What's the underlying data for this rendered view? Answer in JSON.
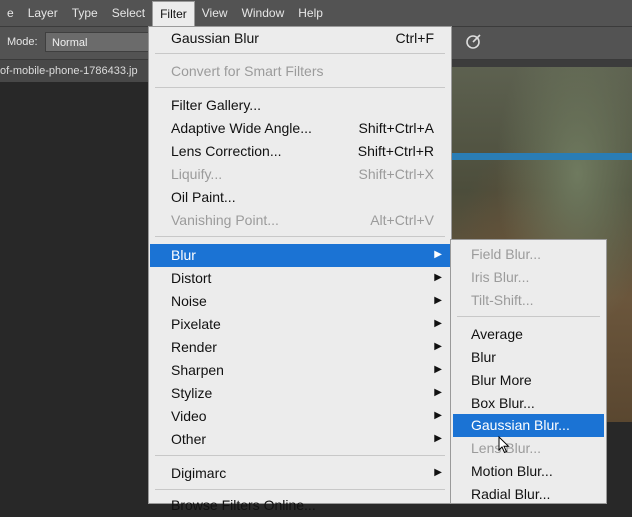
{
  "menubar": {
    "items": [
      "e",
      "Layer",
      "Type",
      "Select",
      "Filter",
      "View",
      "Window",
      "Help"
    ],
    "active": "Filter"
  },
  "options": {
    "mode_label": "Mode:",
    "mode_value": "Normal"
  },
  "document_tab": {
    "title": "of-mobile-phone-1786433.jp"
  },
  "filter_menu": {
    "last_filter": {
      "label": "Gaussian Blur",
      "shortcut": "Ctrl+F"
    },
    "convert_smart": {
      "label": "Convert for Smart Filters"
    },
    "filter_gallery": {
      "label": "Filter Gallery..."
    },
    "adaptive_wide_angle": {
      "label": "Adaptive Wide Angle...",
      "shortcut": "Shift+Ctrl+A"
    },
    "lens_correction": {
      "label": "Lens Correction...",
      "shortcut": "Shift+Ctrl+R"
    },
    "liquify": {
      "label": "Liquify...",
      "shortcut": "Shift+Ctrl+X"
    },
    "oil_paint": {
      "label": "Oil Paint..."
    },
    "vanishing_point": {
      "label": "Vanishing Point...",
      "shortcut": "Alt+Ctrl+V"
    },
    "blur": {
      "label": "Blur"
    },
    "distort": {
      "label": "Distort"
    },
    "noise": {
      "label": "Noise"
    },
    "pixelate": {
      "label": "Pixelate"
    },
    "render": {
      "label": "Render"
    },
    "sharpen": {
      "label": "Sharpen"
    },
    "stylize": {
      "label": "Stylize"
    },
    "video": {
      "label": "Video"
    },
    "other": {
      "label": "Other"
    },
    "digimarc": {
      "label": "Digimarc"
    },
    "browse_online": {
      "label": "Browse Filters Online..."
    }
  },
  "blur_submenu": {
    "field_blur": "Field Blur...",
    "iris_blur": "Iris Blur...",
    "tilt_shift": "Tilt-Shift...",
    "average": "Average",
    "blur": "Blur",
    "blur_more": "Blur More",
    "box_blur": "Box Blur...",
    "gaussian_blur": "Gaussian Blur...",
    "lens_blur": "Lens Blur...",
    "motion_blur": "Motion Blur...",
    "radial_blur": "Radial Blur..."
  },
  "colors": {
    "highlight": "#1b73d4",
    "menu_bg": "#ececec",
    "disabled_text": "#9b9b9b"
  },
  "icons": {
    "submenu_arrow": "chevron-right-icon",
    "airbrush": "airbrush-icon",
    "cursor": "mouse-pointer-icon"
  }
}
